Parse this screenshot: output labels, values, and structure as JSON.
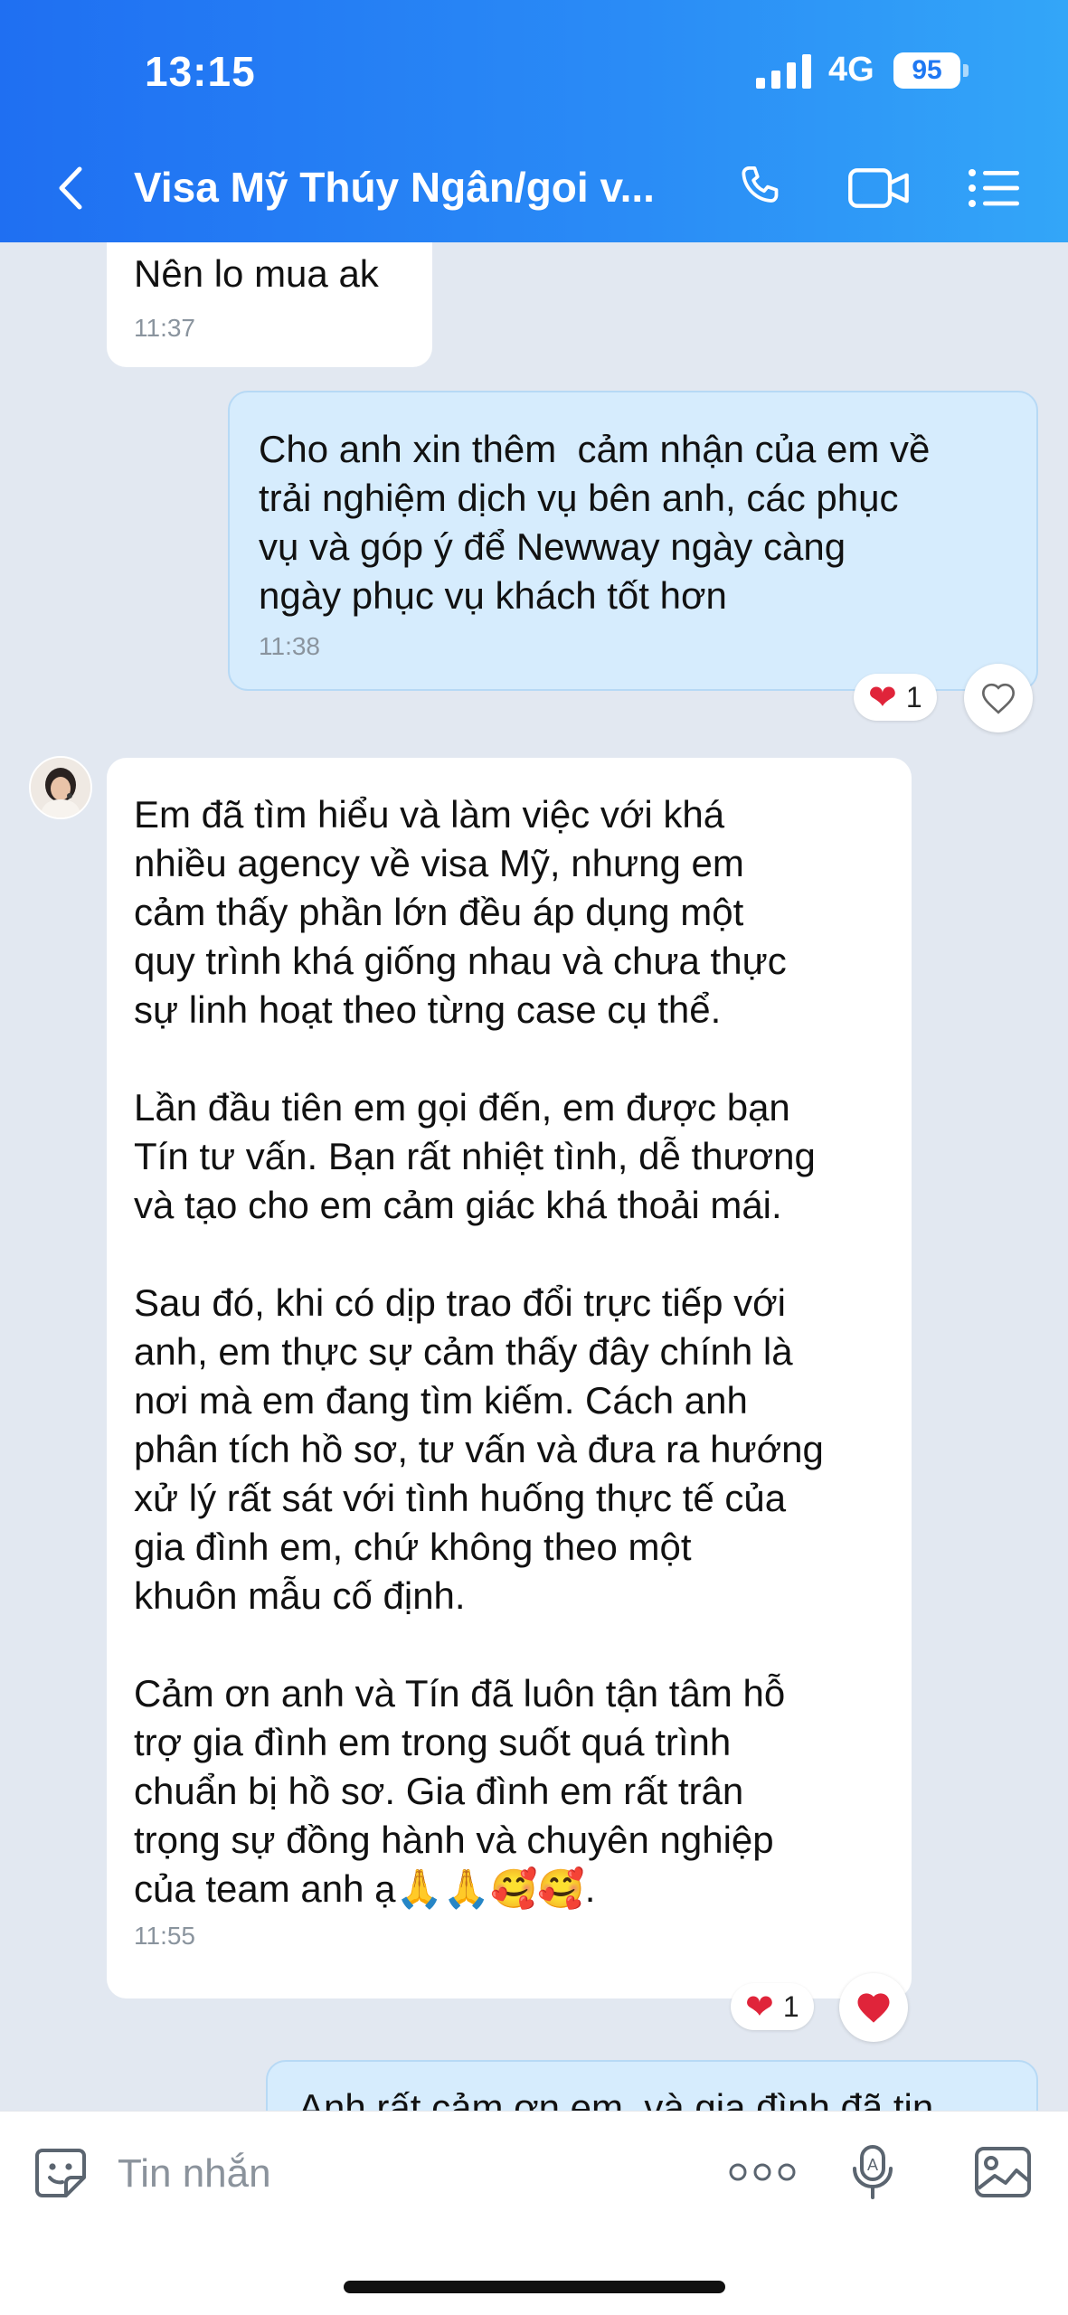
{
  "status_bar": {
    "time": "13:15",
    "network": "4G",
    "battery": "95"
  },
  "header": {
    "title": "Visa Mỹ Thúy Ngân/goi v...",
    "icons": [
      "back-chevron-icon",
      "phone-icon",
      "video-call-icon",
      "menu-list-icon"
    ]
  },
  "messages": [
    {
      "direction": "in",
      "text": "Nên lo mua ak",
      "time": "11:37"
    },
    {
      "direction": "out",
      "text": "Cho anh xin thêm  cảm nhận của em về\ntrải nghiệm dịch vụ bên anh, các phục\nvụ và góp ý để Newway ngày càng\nngày phục vụ khách tốt hơn",
      "time": "11:38",
      "reaction": {
        "emoji": "❤",
        "count": "1"
      }
    },
    {
      "direction": "in",
      "text": "Em đã tìm hiểu và làm việc với khá\nnhiều agency về visa Mỹ, nhưng em\ncảm thấy phần lớn đều áp dụng một\nquy trình khá giống nhau và chưa thực\nsự linh hoạt theo từng case cụ thể.\n\nLần đầu tiên em gọi đến, em được bạn\nTín tư vấn. Bạn rất nhiệt tình, dễ thương\nvà tạo cho em cảm giác khá thoải mái.\n\nSau đó, khi có dịp trao đổi trực tiếp với\nanh, em thực sự cảm thấy đây chính là\nnơi mà em đang tìm kiếm. Cách anh\nphân tích hồ sơ, tư vấn và đưa ra hướng\nxử lý rất sát với tình huống thực tế của\ngia đình em, chứ không theo một\nkhuôn mẫu cố định.\n\nCảm ơn anh và Tín đã luôn tận tâm hỗ\ntrợ gia đình em trong suốt quá trình\nchuẩn bị hồ sơ. Gia đình em rất trân\ntrọng sự đồng hành và chuyên nghiệp\ncủa team anh ạ🙏🙏🥰🥰.",
      "time": "11:55",
      "reaction": {
        "emoji": "❤",
        "count": "1"
      }
    },
    {
      "direction": "out",
      "text": "Anh rất cảm ơn em  và gia đình đã tin"
    }
  ],
  "input": {
    "placeholder": "Tin nhắn",
    "value": ""
  },
  "colors": {
    "header_start": "#1f6ff2",
    "header_end": "#33a6f8",
    "chat_bg": "#e2e8f1",
    "out_bubble": "#d6ecfd",
    "in_bubble": "#ffffff",
    "heart": "#e0243a"
  }
}
